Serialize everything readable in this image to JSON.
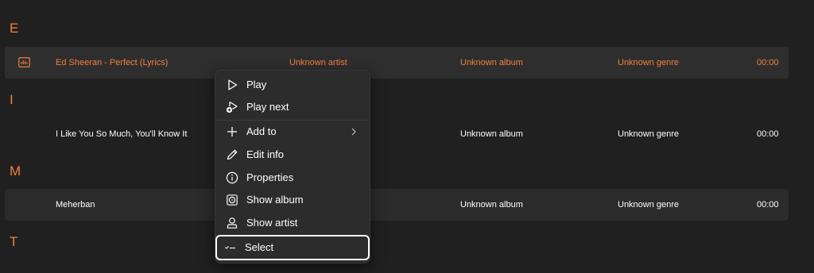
{
  "groups": [
    {
      "letter": "E"
    },
    {
      "letter": "I"
    },
    {
      "letter": "M"
    },
    {
      "letter": "T"
    }
  ],
  "songs": [
    {
      "title": "Ed Sheeran - Perfect (Lyrics)",
      "artist": "Unknown artist",
      "album": "Unknown album",
      "genre": "Unknown genre",
      "duration": "00:00",
      "now_playing": true
    },
    {
      "title": "I Like You So Much, You'll Know It",
      "artist": "",
      "album": "Unknown album",
      "genre": "Unknown genre",
      "duration": "00:00"
    },
    {
      "title": "Meherban",
      "artist": "",
      "album": "Unknown album",
      "genre": "Unknown genre",
      "duration": "00:00"
    }
  ],
  "context_menu": {
    "items": [
      {
        "label": "Play",
        "icon": "play-icon"
      },
      {
        "label": "Play next",
        "icon": "play-next-icon"
      },
      {
        "label": "Add to",
        "icon": "add-icon",
        "submenu": true
      },
      {
        "label": "Edit info",
        "icon": "pencil-icon"
      },
      {
        "label": "Properties",
        "icon": "info-icon"
      },
      {
        "label": "Show album",
        "icon": "album-icon"
      },
      {
        "label": "Show artist",
        "icon": "artist-icon"
      },
      {
        "label": "Select",
        "icon": "select-icon",
        "focused": true
      }
    ]
  },
  "colors": {
    "accent": "#f0803c",
    "background": "#202020",
    "row_background": "#2b2b2b",
    "menu_background": "#2c2c2c"
  }
}
